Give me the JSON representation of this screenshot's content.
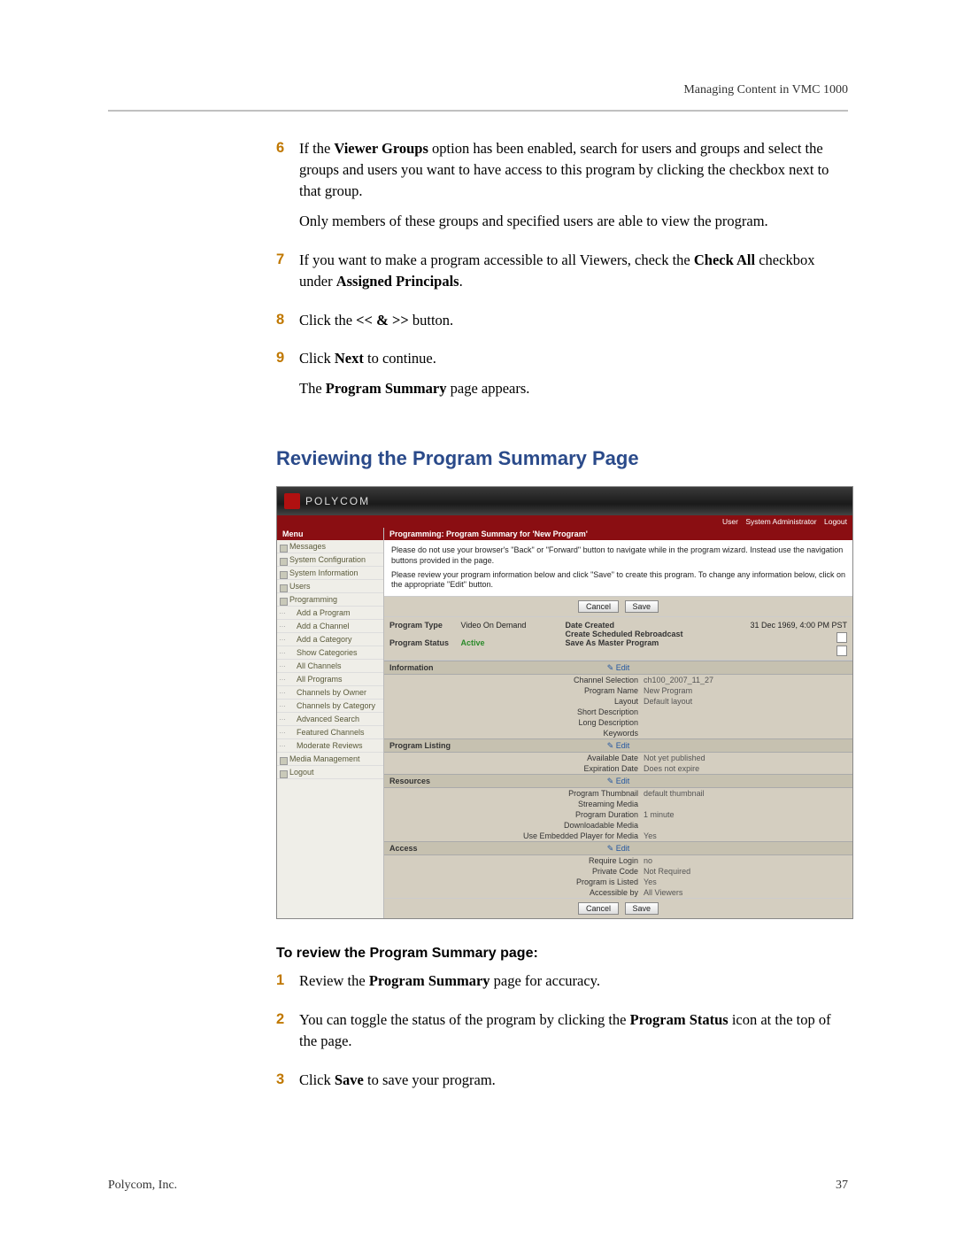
{
  "header": {
    "right": "Managing Content in VMC 1000"
  },
  "steps1": [
    {
      "num": "6",
      "paras": [
        "If the <b>Viewer Groups</b> option has been enabled, search for users and groups and select the groups and users you want to have access to this program by clicking the checkbox next to that group.",
        "Only members of these groups and specified users are able to view the program."
      ]
    },
    {
      "num": "7",
      "paras": [
        "If you want to make a program accessible to all Viewers, check the <b>Check All</b> checkbox under <b>Assigned Principals</b>."
      ]
    },
    {
      "num": "8",
      "paras": [
        "Click the <b>&lt;&lt; &amp; &gt;&gt;</b> button."
      ]
    },
    {
      "num": "9",
      "paras": [
        "Click <b>Next</b> to continue.",
        "The <b>Program Summary</b> page appears."
      ]
    }
  ],
  "section_title": "Reviewing the Program Summary Page",
  "subhead": "To review the Program Summary page:",
  "steps2": [
    {
      "num": "1",
      "paras": [
        "Review the <b>Program Summary</b> page for accuracy."
      ]
    },
    {
      "num": "2",
      "paras": [
        "You can toggle the status of the program by clicking the <b>Program Status</b> icon at the top of the page."
      ]
    },
    {
      "num": "3",
      "paras": [
        "Click <b>Save</b> to save your program."
      ]
    }
  ],
  "footer": {
    "left": "Polycom, Inc.",
    "right": "37"
  },
  "shot": {
    "brand": "POLYCOM",
    "copyright": "",
    "user_label": "User",
    "user_value": "System Administrator",
    "logout": "Logout",
    "menu_head": "Menu",
    "menu": [
      {
        "t": "Messages",
        "cls": "top"
      },
      {
        "t": "System Configuration",
        "cls": "top"
      },
      {
        "t": "System Information",
        "cls": "top"
      },
      {
        "t": "Users",
        "cls": "top"
      },
      {
        "t": "Programming",
        "cls": "top"
      },
      {
        "t": "Add a Program",
        "cls": "sub indent"
      },
      {
        "t": "Add a Channel",
        "cls": "sub indent"
      },
      {
        "t": "Add a Category",
        "cls": "sub indent"
      },
      {
        "t": "Show Categories",
        "cls": "sub indent"
      },
      {
        "t": "All Channels",
        "cls": "sub indent"
      },
      {
        "t": "All Programs",
        "cls": "sub indent"
      },
      {
        "t": "Channels by Owner",
        "cls": "sub indent"
      },
      {
        "t": "Channels by Category",
        "cls": "sub indent"
      },
      {
        "t": "Advanced Search",
        "cls": "sub indent"
      },
      {
        "t": "Featured Channels",
        "cls": "sub indent"
      },
      {
        "t": "Moderate Reviews",
        "cls": "sub indent"
      },
      {
        "t": "Media Management",
        "cls": "top"
      },
      {
        "t": "Logout",
        "cls": "top"
      }
    ],
    "crumb": "Programming: Program Summary for 'New Program'",
    "notice1": "Please do not use your browser's \"Back\" or \"Forward\" button to navigate while in the program wizard. Instead use the navigation buttons provided in the page.",
    "notice2": "Please review your program information below and click \"Save\" to create this program. To change any information below, click on the appropriate \"Edit\" button.",
    "btn_cancel": "Cancel",
    "btn_save": "Save",
    "status": {
      "program_type_l": "Program Type",
      "program_type_v": "Video On Demand",
      "program_status_l": "Program Status",
      "program_status_v": "Active",
      "date_created_l": "Date Created",
      "date_created_v": "31 Dec 1969, 4:00 PM PST",
      "rebroadcast_l": "Create Scheduled Rebroadcast",
      "save_master_l": "Save As Master Program"
    },
    "edit": "Edit",
    "sections": {
      "information": {
        "title": "Information",
        "rows": [
          {
            "k": "Channel Selection",
            "v": "ch100_2007_11_27"
          },
          {
            "k": "Program Name",
            "v": "New Program"
          },
          {
            "k": "Layout",
            "v": "Default layout"
          },
          {
            "k": "Short Description",
            "v": ""
          },
          {
            "k": "Long Description",
            "v": ""
          },
          {
            "k": "Keywords",
            "v": ""
          }
        ]
      },
      "program_listing": {
        "title": "Program Listing",
        "rows": [
          {
            "k": "Available Date",
            "v": "Not yet published"
          },
          {
            "k": "Expiration Date",
            "v": "Does not expire"
          }
        ]
      },
      "resources": {
        "title": "Resources",
        "rows": [
          {
            "k": "Program Thumbnail",
            "v": "default thumbnail"
          },
          {
            "k": "Streaming Media",
            "v": ""
          },
          {
            "k": "Program Duration",
            "v": "1 minute"
          },
          {
            "k": "Downloadable Media",
            "v": ""
          },
          {
            "k": "Use Embedded Player for Media",
            "v": "Yes"
          }
        ]
      },
      "access": {
        "title": "Access",
        "rows": [
          {
            "k": "Require Login",
            "v": "no"
          },
          {
            "k": "Private Code",
            "v": "Not Required"
          },
          {
            "k": "Program is Listed",
            "v": "Yes"
          },
          {
            "k": "Accessible by",
            "v": "All Viewers"
          }
        ]
      }
    }
  }
}
